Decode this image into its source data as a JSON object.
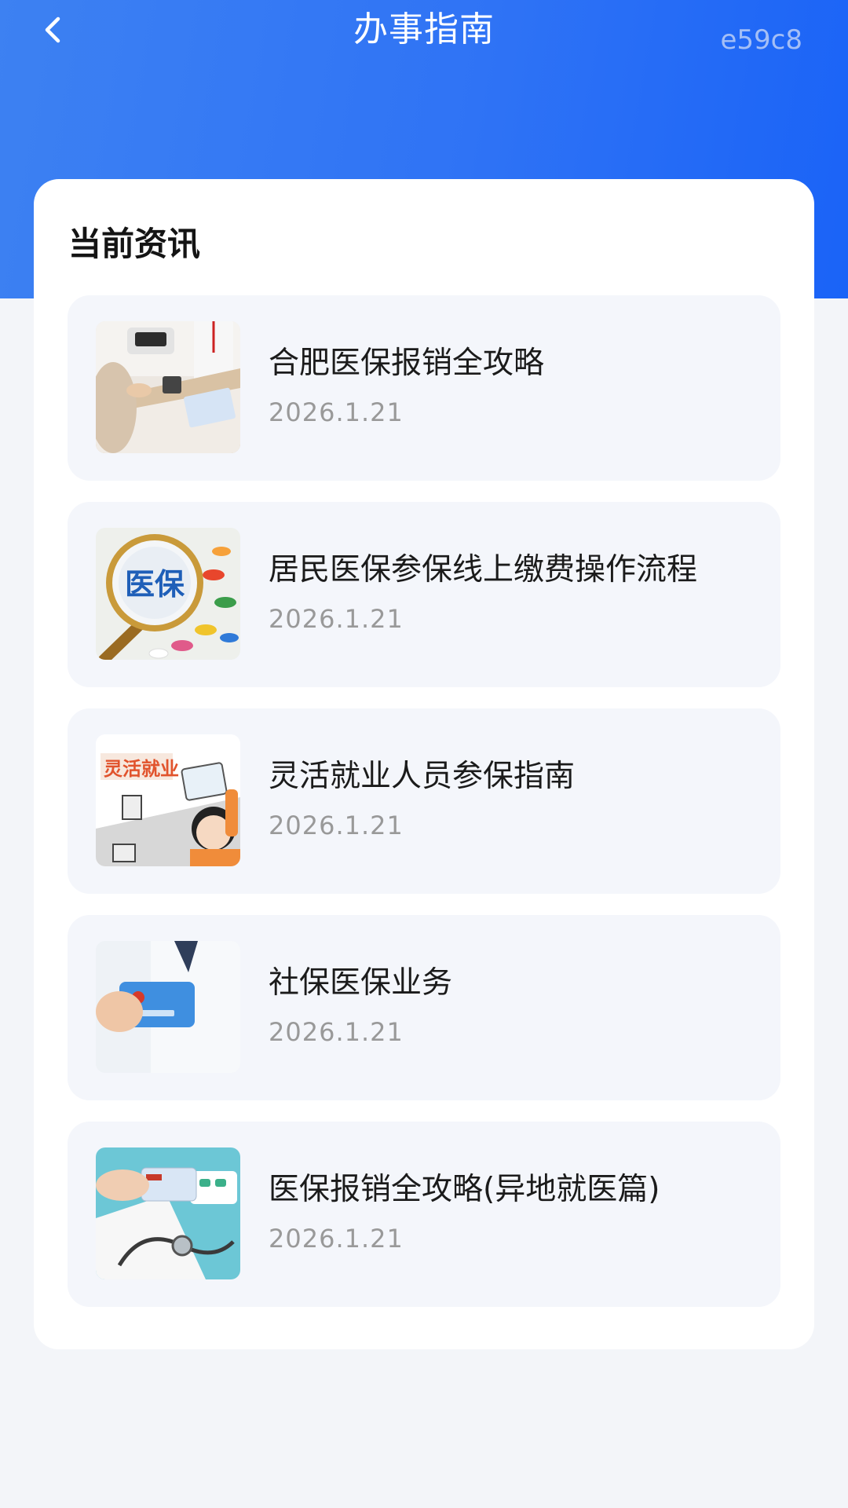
{
  "header": {
    "title": "办事指南",
    "watermark": "e59c8",
    "back_icon": "chevron-left-icon"
  },
  "section": {
    "title": "当前资讯"
  },
  "articles": [
    {
      "title": "合肥医保报销全攻略",
      "date": "2026.1.21",
      "thumbnail": "hospital-counter-photo"
    },
    {
      "title": "居民医保参保线上缴费操作流程",
      "date": "2026.1.21",
      "thumbnail": "magnifier-pills-photo",
      "thumb_text": "医保"
    },
    {
      "title": "灵活就业人员参保指南",
      "date": "2026.1.21",
      "thumbnail": "flexible-employment-cartoon",
      "thumb_text": "灵活就业"
    },
    {
      "title": "社保医保业务",
      "date": "2026.1.21",
      "thumbnail": "social-security-card-photo"
    },
    {
      "title": "医保报销全攻略(异地就医篇)",
      "date": "2026.1.21",
      "thumbnail": "stethoscope-card-photo"
    }
  ],
  "colors": {
    "header_gradient_start": "#3d81f2",
    "header_gradient_end": "#1a63f7",
    "page_background": "#f3f5f9",
    "card_background": "#ffffff",
    "item_background": "#f4f6fb",
    "date_text": "#999999"
  }
}
